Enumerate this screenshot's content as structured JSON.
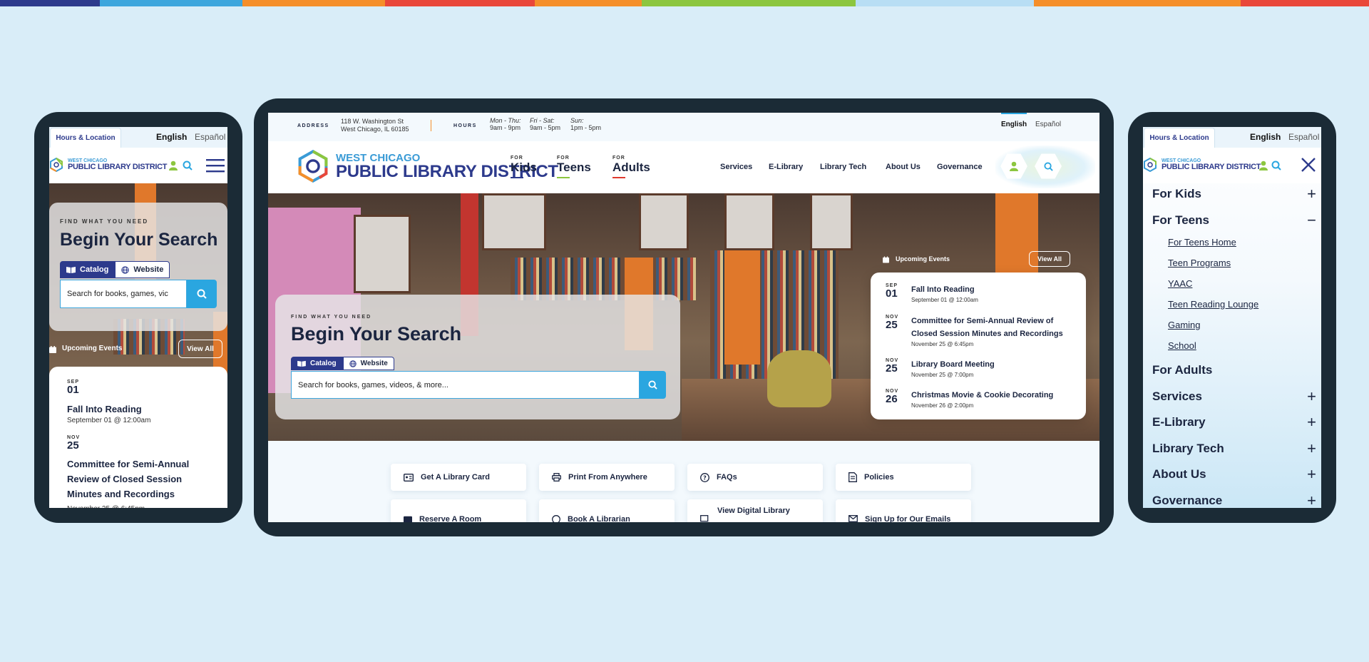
{
  "colors": {
    "background": "#d9edf8",
    "device_frame": "#1b2b36",
    "brand_navy": "#2d3a8c",
    "brand_blue": "#2aa6e0",
    "kids_accent": "#2d3a8c",
    "teens_accent": "#8cc63f",
    "adults_accent": "#e03a2f",
    "top_stripe": [
      "#2d3a8c",
      "#3da6dd",
      "#f58f2a",
      "#e9473a",
      "#f58f2a",
      "#8cc63f",
      "#b8def4",
      "#f58f2a",
      "#e9473a"
    ]
  },
  "logo": {
    "small": "WEST CHICAGO",
    "big": "PUBLIC LIBRARY DISTRICT"
  },
  "languages": {
    "english": "English",
    "spanish": "Español"
  },
  "hours_location_tab": "Hours & Location",
  "search": {
    "eyebrow": "FIND WHAT YOU NEED",
    "heading": "Begin Your Search",
    "tab_catalog": "Catalog",
    "tab_website": "Website",
    "placeholder_desktop": "Search for books, games, videos, & more...",
    "placeholder_mobile": "Search for books, games, vic"
  },
  "desktop": {
    "info": {
      "address_label": "ADDRESS",
      "address_line1": "118 W. Washington St",
      "address_line2": "West Chicago, IL 60185",
      "hours_label": "HOURS",
      "hours": [
        {
          "days": "Mon - Thu:",
          "time": "9am - 9pm"
        },
        {
          "days": "Fri - Sat:",
          "time": "9am - 5pm"
        },
        {
          "days": "Sun:",
          "time": "1pm - 5pm"
        }
      ]
    },
    "audience_nav": [
      {
        "for": "FOR",
        "label": "Kids"
      },
      {
        "for": "FOR",
        "label": "Teens"
      },
      {
        "for": "FOR",
        "label": "Adults"
      }
    ],
    "main_nav": [
      "Services",
      "E-Library",
      "Library Tech",
      "About Us",
      "Governance"
    ],
    "quick_links": [
      "Get A Library Card",
      "Print From Anywhere",
      "FAQs",
      "Policies",
      "Reserve A Room",
      "Book A Librarian",
      "View Digital Library",
      "Sign Up for Our Emails"
    ]
  },
  "events": {
    "heading": "Upcoming Events",
    "view_all": "View All",
    "items": [
      {
        "month": "SEP",
        "day": "01",
        "title": "Fall Into Reading",
        "when": "September 01 @ 12:00am"
      },
      {
        "month": "NOV",
        "day": "25",
        "title": "Committee for Semi-Annual Review of Closed Session Minutes and Recordings",
        "when": "November 25 @ 6:45pm"
      },
      {
        "month": "NOV",
        "day": "25",
        "title": "Library Board Meeting",
        "when": "November 25 @ 7:00pm"
      },
      {
        "month": "NOV",
        "day": "26",
        "title": "Christmas Movie & Cookie Decorating",
        "when": "November 26 @ 2:00pm"
      }
    ],
    "mobile_title_lines": [
      "Committee for Semi-Annual",
      "Review of Closed Session",
      "Minutes and Recordings"
    ]
  },
  "mobile_menu": {
    "items": [
      {
        "label": "For Kids",
        "toggle": "+"
      },
      {
        "label": "For Teens",
        "toggle": "−"
      },
      {
        "label": "For Adults",
        "toggle": ""
      },
      {
        "label": "Services",
        "toggle": "+"
      },
      {
        "label": "E-Library",
        "toggle": "+"
      },
      {
        "label": "Library Tech",
        "toggle": "+"
      },
      {
        "label": "About Us",
        "toggle": "+"
      },
      {
        "label": "Governance",
        "toggle": "+"
      }
    ],
    "teens_sub": [
      "For Teens Home",
      "Teen Programs",
      "YAAC",
      "Teen Reading Lounge",
      "Gaming",
      "School"
    ]
  }
}
